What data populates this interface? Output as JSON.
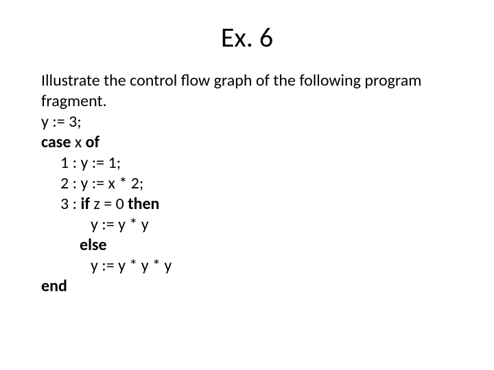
{
  "title": "Ex. 6",
  "lines": {
    "l1": "Illustrate the control flow graph of the following program fragment.",
    "l2": "y := 3;",
    "l3a": "case",
    "l3b": " x ",
    "l3c": "of",
    "l4": "1 : y := 1;",
    "l5": "2 : y := x * 2;",
    "l6a": "3 : ",
    "l6b": "if",
    "l6c": " z = 0 ",
    "l6d": "then",
    "l7": "y := y * y",
    "l8": "else",
    "l9": "y := y * y * y",
    "l10": "end"
  }
}
